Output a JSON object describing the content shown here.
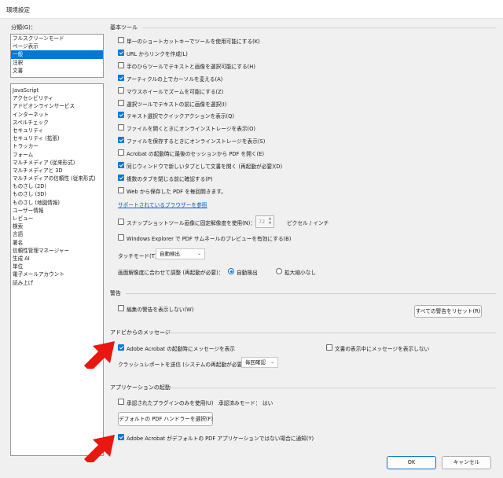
{
  "window": {
    "title": "環境設定"
  },
  "categories": {
    "label": "分類(G)：",
    "top": [
      {
        "label": "フルスクリーンモード",
        "selected": false
      },
      {
        "label": "ページ表示",
        "selected": false
      },
      {
        "label": "一般",
        "selected": true
      },
      {
        "label": "注釈",
        "selected": false
      },
      {
        "label": "文書",
        "selected": false
      }
    ],
    "rest": [
      "JavaScript",
      "アクセシビリティ",
      "アドビオンラインサービス",
      "インターネット",
      "スペルチェック",
      "セキュリティ",
      "セキュリティ (拡張)",
      "トラッカー",
      "フォーム",
      "マルチメディア (従来形式)",
      "マルチメディアと 3D",
      "マルチメディアの信頼性 (従来形式)",
      "ものさし (2D)",
      "ものさし (3D)",
      "ものさし (地図情報)",
      "ユーザー情報",
      "レビュー",
      "検索",
      "言語",
      "署名",
      "信頼性管理マネージャー",
      "生成 AI",
      "単位",
      "電子メールアカウント",
      "読み上げ"
    ]
  },
  "basic_tools": {
    "title": "基本ツール",
    "options": [
      {
        "label": "単一のショートカットキーでツールを使用可能にする(K)",
        "checked": false
      },
      {
        "label": "URL からリンクを作成(L)",
        "checked": true
      },
      {
        "label": "手のひらツールでテキストと画像を選択可能にする(H)",
        "checked": false
      },
      {
        "label": "アーティクルの上でカーソルを変える(A)",
        "checked": true
      },
      {
        "label": "マウスホイールでズームを可能にする(Z)",
        "checked": false
      },
      {
        "label": "選択ツールでテキストの前に画像を選択(I)",
        "checked": false
      },
      {
        "label": "テキスト選択でクイックアクションを表示(Q)",
        "checked": true
      },
      {
        "label": "ファイルを開くときにオンラインストレージを表示(O)",
        "checked": false
      },
      {
        "label": "ファイルを保存するときにオンラインストレージを表示(S)",
        "checked": true
      },
      {
        "label": "Acrobat の起動時に最後のセッションから PDF を開く(E)",
        "checked": false
      },
      {
        "label": "同じウィンドウで新しいタブとして文書を開く (再起動が必要)(D)",
        "checked": true
      },
      {
        "label": "複数のタブを閉じる前に確認する(P)",
        "checked": true
      },
      {
        "label": "Web から保存した PDF を毎回開きます。",
        "checked": false
      }
    ],
    "browser_link": "サポートされているブラウザーを参照",
    "snapshot": {
      "label": "スナップショットツール画像に固定解像度を使用(N)：",
      "value": "72",
      "unit": "ピクセル / インチ",
      "checked": false
    },
    "explorer": {
      "label": "Windows Explorer で PDF サムネールのプレビューを有効にする(B)",
      "checked": false
    },
    "touch_mode": {
      "label": "タッチモード(T)：",
      "value": "自動検出"
    },
    "resolution": {
      "label": "画面解像度に合わせて調整 (再起動が必要)：",
      "opt1": "自動検出",
      "opt2": "拡大縮小なし"
    }
  },
  "warnings": {
    "title": "警告",
    "hide_edit": {
      "label": "編集の警告を表示しない(W)",
      "checked": false
    },
    "reset_button": "すべての警告をリセット(R)"
  },
  "adobe_messages": {
    "title": "アドビからのメッセージ",
    "on_start": {
      "label": "Adobe Acrobat の起動時にメッセージを表示",
      "checked": true
    },
    "while_viewing": {
      "label": "文書の表示中にメッセージを表示しない",
      "checked": false
    },
    "crash": {
      "label": "クラッシュレポートを送信 (システムの再起動が必要)：",
      "value": "毎回確認"
    }
  },
  "app_startup": {
    "title": "アプリケーションの起動",
    "certified": {
      "label": "承認されたプラグインのみを使用(U)",
      "checked": false
    },
    "certified_mode_label": "承認済みモード：",
    "certified_mode_value": "はい",
    "default_handler_button": "デフォルトの PDF ハンドラーを選択(F)",
    "notify": {
      "label": "Adobe Acrobat がデフォルトの PDF アプリケーションではない場合に通知(Y)",
      "checked": true
    }
  },
  "footer": {
    "ok": "OK",
    "cancel": "キャンセル"
  },
  "colors": {
    "accent": "#0078d7",
    "annotation_arrow": "#e8170f"
  }
}
